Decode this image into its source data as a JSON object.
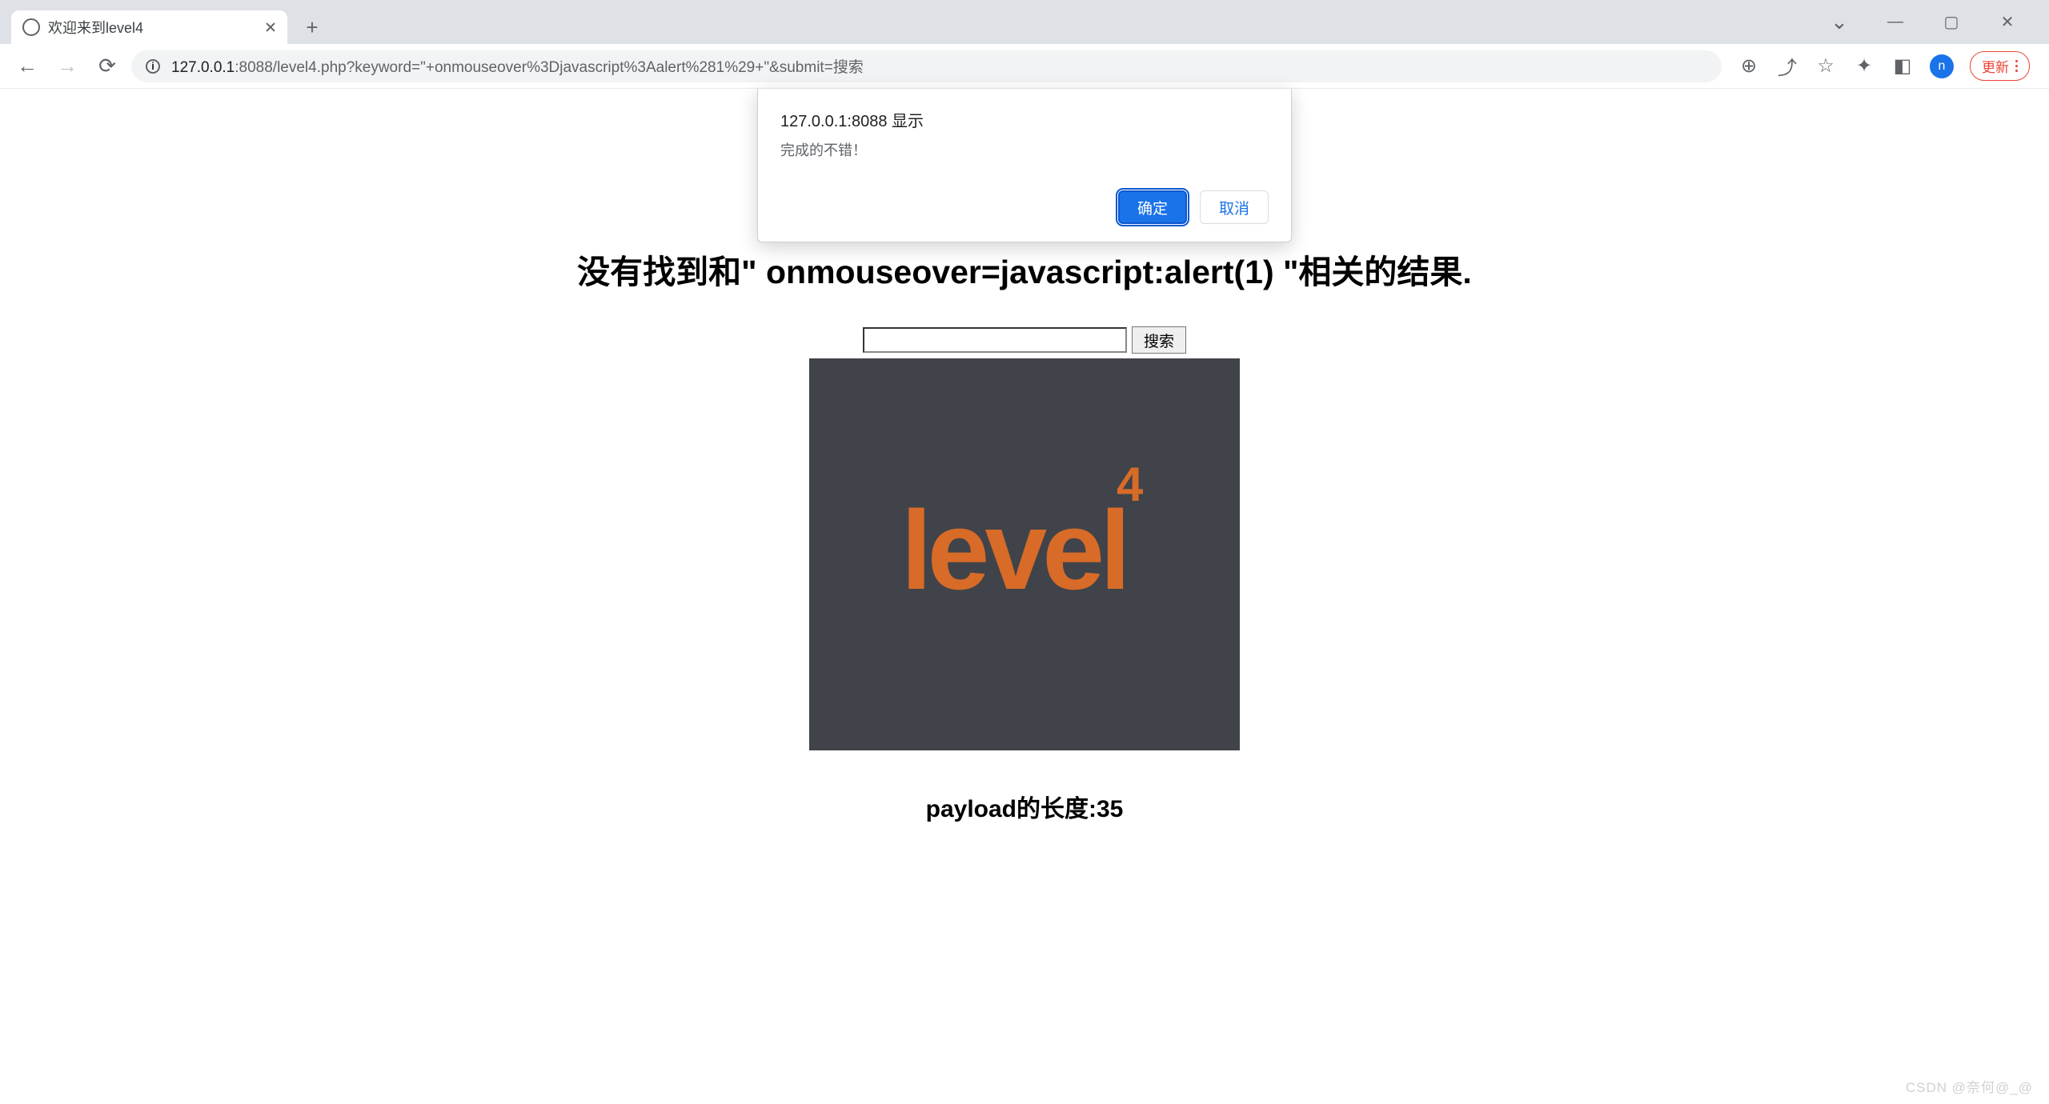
{
  "browser": {
    "tab_title": "欢迎来到level4",
    "new_tab_glyph": "+",
    "window_controls": {
      "chevron": "⌄",
      "minimize": "—",
      "maximize": "▢",
      "close": "✕"
    }
  },
  "address": {
    "info_glyph": "i",
    "host": "127.0.0.1",
    "port": ":8088",
    "path": "/level4.php?keyword=\"+onmouseover%3Djavascript%3Aalert%281%29+\"&submit=搜索"
  },
  "toolbar_icons": {
    "back": "←",
    "forward": "→",
    "reload": "⟳",
    "zoom": "⊕",
    "share": "⤴",
    "bookmark": "☆",
    "extensions": "✦",
    "side_panel": "◧",
    "avatar": "n",
    "update_label": "更新"
  },
  "dialog": {
    "title": "127.0.0.1:8088 显示",
    "message": "完成的不错！",
    "ok": "确定",
    "cancel": "取消"
  },
  "page": {
    "heading": "没有找到和\" onmouseover=javascript:alert(1) \"相关的结果.",
    "search_value": "",
    "search_button": "搜索",
    "logo_text": "level",
    "logo_sup": "4",
    "payload_text": "payload的长度:35"
  },
  "watermark": "CSDN @奈何@_@"
}
